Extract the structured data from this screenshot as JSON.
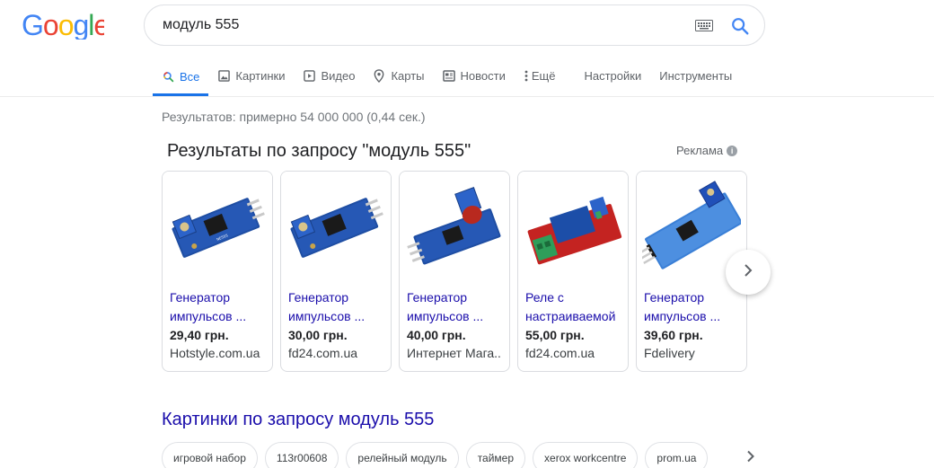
{
  "search": {
    "query": "модуль 555"
  },
  "tabs": [
    {
      "label": "Все",
      "icon": "search-icon",
      "active": true
    },
    {
      "label": "Картинки",
      "icon": "image-icon"
    },
    {
      "label": "Видео",
      "icon": "video-icon"
    },
    {
      "label": "Карты",
      "icon": "map-pin-icon"
    },
    {
      "label": "Новости",
      "icon": "news-icon"
    },
    {
      "label": "Ещё",
      "icon": "more-vert-icon"
    },
    {
      "label": "Настройки"
    },
    {
      "label": "Инструменты"
    }
  ],
  "stats": "Результатов: примерно 54 000 000 (0,44 сек.)",
  "ads": {
    "title": "Результаты по запросу \"модуль 555\"",
    "label": "Реклама",
    "products": [
      {
        "title": "Генератор импульсов ...",
        "price": "29,40 грн.",
        "store": "Hotstyle.com.ua",
        "image": "blue-555-module"
      },
      {
        "title": "Генератор импульсов ...",
        "price": "30,00 грн.",
        "store": "fd24.com.ua",
        "image": "blue-555-module"
      },
      {
        "title": "Генератор импульсов ...",
        "price": "40,00 грн.",
        "store": "Интернет Мага...",
        "image": "blue-555-module-red-pot"
      },
      {
        "title": "Реле с настраиваемой",
        "price": "55,00 грн.",
        "store": "fd24.com.ua",
        "image": "red-relay-module"
      },
      {
        "title": "Генератор импульсов ...",
        "price": "39,60 грн.",
        "store": "Fdelivery",
        "image": "blue-555-module-light"
      }
    ]
  },
  "images_section": {
    "title": "Картинки по запросу модуль 555",
    "chips": [
      "игровой набор",
      "113r00608",
      "релейный модуль",
      "таймер",
      "xerox workcentre",
      "prom.ua"
    ]
  },
  "colors": {
    "link": "#1a0dab",
    "accent": "#1a73e8",
    "muted": "#70757a"
  }
}
